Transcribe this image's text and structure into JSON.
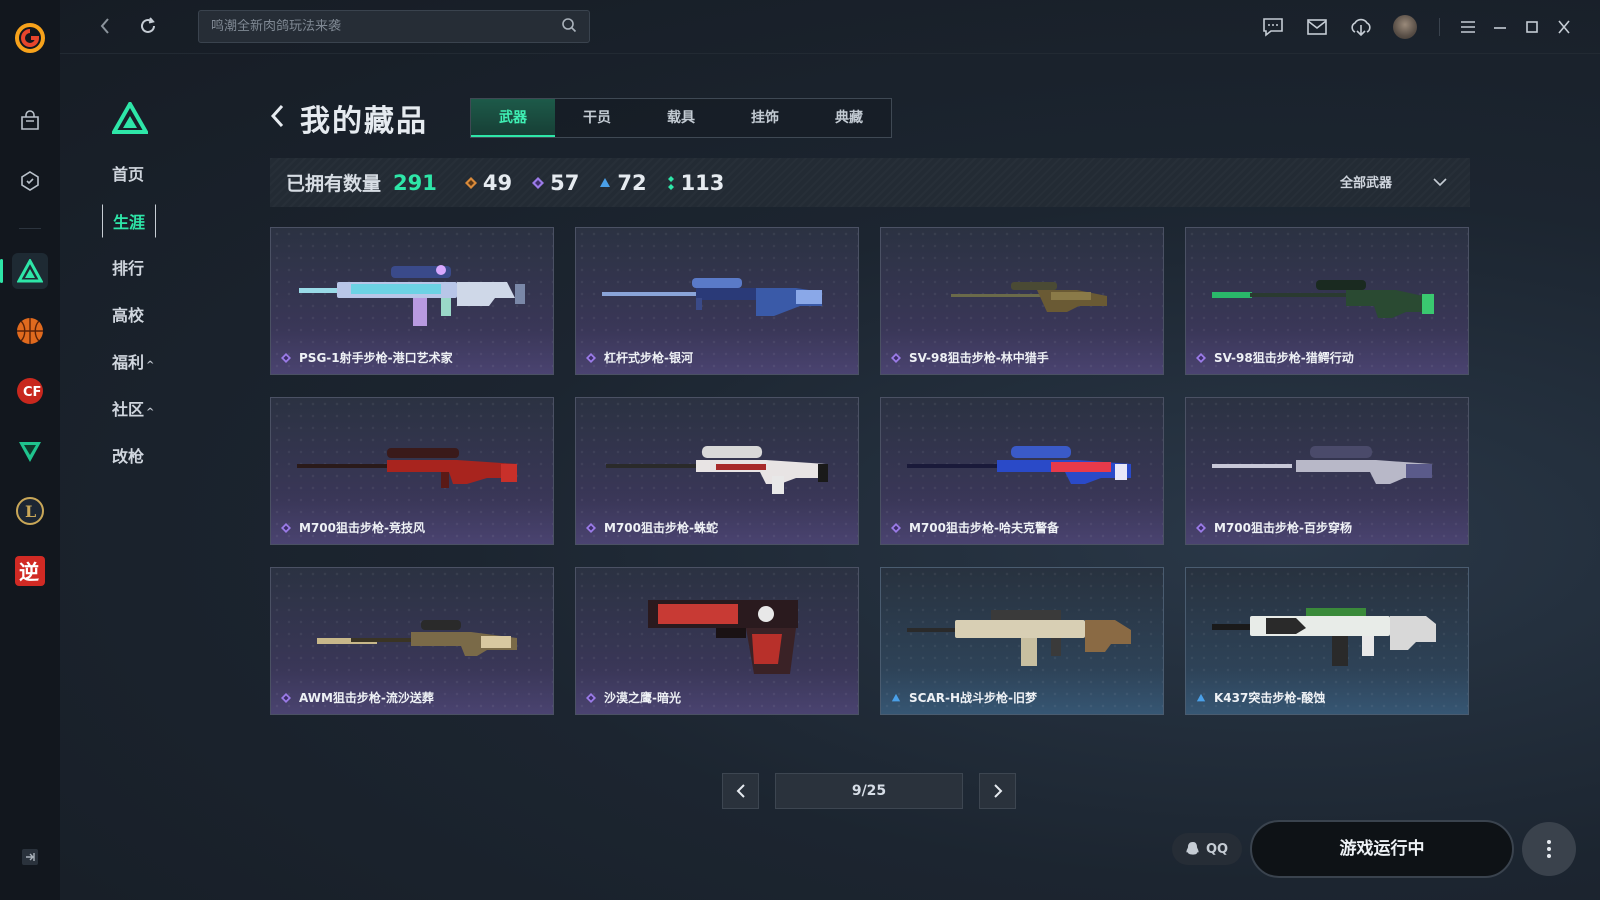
{
  "search": {
    "placeholder": "鸣潮全新肉鸽玩法来袭"
  },
  "sidebar": {
    "items": [
      {
        "label": "首页"
      },
      {
        "label": "生涯"
      },
      {
        "label": "排行"
      },
      {
        "label": "高校"
      },
      {
        "label": "福利",
        "caret": "^"
      },
      {
        "label": "社区",
        "caret": "^"
      },
      {
        "label": "改枪"
      }
    ]
  },
  "page": {
    "title": "我的藏品"
  },
  "tabs": [
    "武器",
    "干员",
    "载具",
    "挂饰",
    "典藏"
  ],
  "stats": {
    "owned_label": "已拥有数量",
    "total": "291",
    "rarity": [
      {
        "icon": "orange-diamond-icon",
        "color": "#d98a3a",
        "count": "49"
      },
      {
        "icon": "purple-diamond-icon",
        "color": "#9b7be8",
        "count": "57"
      },
      {
        "icon": "blue-diamond-icon",
        "color": "#4aa0e8",
        "count": "72"
      },
      {
        "icon": "green-diamond-icon",
        "color": "#2ee6a8",
        "count": "113"
      }
    ],
    "filter": "全部武器"
  },
  "items": [
    {
      "name": "PSG-1射手步枪-港口艺术家",
      "rarity": "purple"
    },
    {
      "name": "杠杆式步枪-银河",
      "rarity": "purple"
    },
    {
      "name": "SV-98狙击步枪-林中猎手",
      "rarity": "purple"
    },
    {
      "name": "SV-98狙击步枪-猎鳄行动",
      "rarity": "purple"
    },
    {
      "name": "M700狙击步枪-竞技风",
      "rarity": "purple"
    },
    {
      "name": "M700狙击步枪-蛛蛇",
      "rarity": "purple"
    },
    {
      "name": "M700狙击步枪-哈夫克警备",
      "rarity": "purple"
    },
    {
      "name": "M700狙击步枪-百步穿杨",
      "rarity": "purple"
    },
    {
      "name": "AWM狙击步枪-流沙送葬",
      "rarity": "purple"
    },
    {
      "name": "沙漠之鹰-暗光",
      "rarity": "purple"
    },
    {
      "name": "SCAR-H战斗步枪-旧梦",
      "rarity": "blue"
    },
    {
      "name": "K437突击步枪-酸蚀",
      "rarity": "blue"
    }
  ],
  "pager": {
    "current": "9/25"
  },
  "footer": {
    "qq_label": "QQ",
    "play_label": "游戏运行中"
  },
  "colors": {
    "accent": "#2ee6a8",
    "purple_card": "#3a3758",
    "blue_card": "#2e4358"
  }
}
